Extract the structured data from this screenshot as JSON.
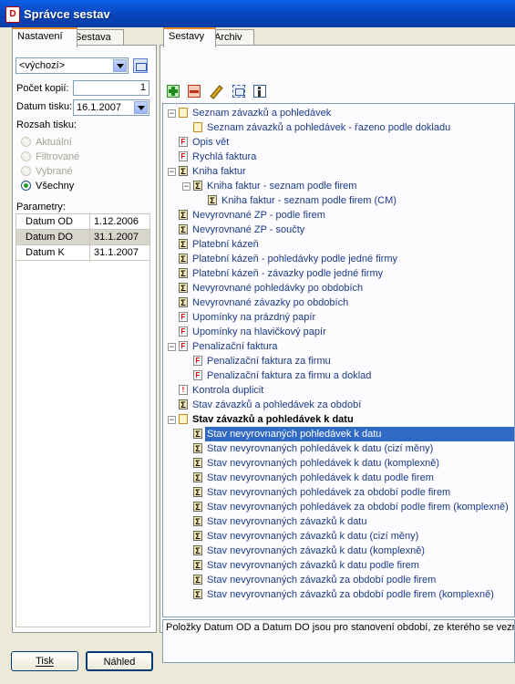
{
  "window": {
    "title": "Správce sestav",
    "app_icon": "app-icon"
  },
  "left_tabs": [
    "Nastavení",
    "Sestava"
  ],
  "left": {
    "profile_value": "<výchozí>",
    "copies_label": "Počet kopií:",
    "copies_value": "1",
    "date_label": "Datum tisku:",
    "date_value": "16.1.2007",
    "range_label": "Rozsah tisku:",
    "range_options": [
      {
        "label": "Aktuální",
        "checked": false
      },
      {
        "label": "Filtrované",
        "checked": false
      },
      {
        "label": "Vybrané",
        "checked": false
      },
      {
        "label": "Všechny",
        "checked": true
      }
    ],
    "params_label": "Parametry:",
    "params": [
      {
        "name": "Datum OD",
        "value": "1.12.2006"
      },
      {
        "name": "Datum DO",
        "value": "31.1.2007"
      },
      {
        "name": "Datum K",
        "value": "31.1.2007"
      }
    ]
  },
  "right_tabs": [
    "Sestavy",
    "Archiv"
  ],
  "toolbar_icons": [
    "add-icon",
    "delete-icon",
    "edit-icon",
    "properties-icon",
    "info-icon"
  ],
  "tree": [
    {
      "label": "Seznam závazků a pohledávek",
      "icon": "doc",
      "toggle": "−"
    },
    {
      "label": "Seznam závazků a pohledávek - řazeno podle dokladu",
      "icon": "doc"
    },
    {
      "label": "Opis vět",
      "icon": "F"
    },
    {
      "label": "Rychlá faktura",
      "icon": "F"
    },
    {
      "label": "Kniha faktur",
      "icon": "S",
      "toggle": "−"
    },
    {
      "label": "Kniha faktur - seznam podle firem",
      "icon": "S",
      "toggle": "−"
    },
    {
      "label": "Kniha faktur - seznam podle firem (CM)",
      "icon": "S"
    },
    {
      "label": "Nevyrovnané ZP - podle firem",
      "icon": "S"
    },
    {
      "label": "Nevyrovnané ZP - součty",
      "icon": "S"
    },
    {
      "label": "Platební kázeň",
      "icon": "S"
    },
    {
      "label": "Platební kázeň - pohledávky podle jedné firmy",
      "icon": "S"
    },
    {
      "label": "Platební kázeň - závazky podle jedné firmy",
      "icon": "S"
    },
    {
      "label": "Nevyrovnané pohledávky po obdobích",
      "icon": "S"
    },
    {
      "label": "Nevyrovnané závazky po obdobích",
      "icon": "S"
    },
    {
      "label": "Upomínky na prázdný papír",
      "icon": "F"
    },
    {
      "label": "Upomínky na hlavičkový papír",
      "icon": "F"
    },
    {
      "label": "Penalizační faktura",
      "icon": "F",
      "toggle": "−"
    },
    {
      "label": "Penalizační faktura za firmu",
      "icon": "F"
    },
    {
      "label": "Penalizační faktura za firmu a doklad",
      "icon": "F"
    },
    {
      "label": "Kontrola duplicit",
      "icon": "excl"
    },
    {
      "label": "Stav závazků a pohledávek za období",
      "icon": "S"
    },
    {
      "label": "Stav závazků a pohledávek k datu",
      "icon": "doc",
      "toggle": "−"
    },
    {
      "label": "Stav nevyrovnaných pohledávek k datu",
      "icon": "S"
    },
    {
      "label": "Stav nevyrovnaných pohledávek k datu (cizí měny)",
      "icon": "S"
    },
    {
      "label": "Stav nevyrovnaných pohledávek k datu (komplexně)",
      "icon": "S"
    },
    {
      "label": "Stav nevyrovnaných pohledávek k datu podle firem",
      "icon": "S"
    },
    {
      "label": "Stav nevyrovnaných pohledávek za období podle firem",
      "icon": "S"
    },
    {
      "label": "Stav nevyrovnaných pohledávek za období podle firem (komplexně)",
      "icon": "S"
    },
    {
      "label": "Stav nevyrovnaných závazků k datu",
      "icon": "S"
    },
    {
      "label": "Stav nevyrovnaných závazků k datu (cizí měny)",
      "icon": "S"
    },
    {
      "label": "Stav nevyrovnaných závazků k datu (komplexně)",
      "icon": "S"
    },
    {
      "label": "Stav nevyrovnaných závazků k datu podle firem",
      "icon": "S"
    },
    {
      "label": "Stav nevyrovnaných závazků za období podle firem",
      "icon": "S"
    },
    {
      "label": "Stav nevyrovnaných závazků za období podle firem (komplexně)",
      "icon": "S"
    }
  ],
  "selected_report": "Stav nevyrovnaných pohledávek k datu",
  "info_text": "Položky Datum OD a Datum DO jsou pro stanovení období, ze kterého se vezmou",
  "buttons": {
    "print": "Tisk",
    "preview": "Náhled"
  },
  "colors": {
    "selection": "#316ac5",
    "title_bar": "#0a5fe6",
    "tab_accent": "#e68b2c",
    "tree_text": "#1b3a8c"
  }
}
